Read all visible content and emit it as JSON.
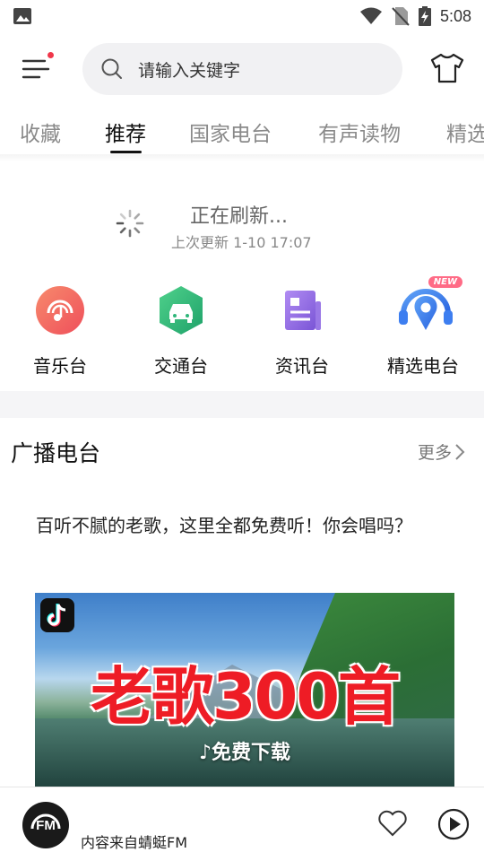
{
  "status_bar": {
    "time": "5:08"
  },
  "search": {
    "placeholder": "请输入关键字"
  },
  "tabs": [
    {
      "label": "收藏"
    },
    {
      "label": "推荐",
      "active": true
    },
    {
      "label": "国家电台"
    },
    {
      "label": "有声读物"
    },
    {
      "label": "精选"
    }
  ],
  "refresh": {
    "title": "正在刷新...",
    "last_update": "上次更新 1-10 17:07"
  },
  "categories": [
    {
      "label": "音乐台",
      "icon": "music-radio-icon",
      "color": "#f2665e"
    },
    {
      "label": "交通台",
      "icon": "car-icon",
      "color": "#2fb67a"
    },
    {
      "label": "资讯台",
      "icon": "news-icon",
      "color": "#8f6ee0"
    },
    {
      "label": "精选电台",
      "icon": "location-headphone-icon",
      "color": "#3d7ef0",
      "badge": "NEW"
    }
  ],
  "section": {
    "title": "广播电台",
    "more": "更多"
  },
  "article": {
    "title": "百听不腻的老歌，这里全都免费听！你会唱吗？"
  },
  "banner": {
    "headline": "老歌300首",
    "subtitle": "♪免费下载"
  },
  "player": {
    "logo_text": "FM",
    "source": "内容来自蜻蜓FM"
  },
  "colors": {
    "accent_dot": "#f0374a",
    "badge": "#ff6b86",
    "headline_red": "#ee1c25"
  }
}
